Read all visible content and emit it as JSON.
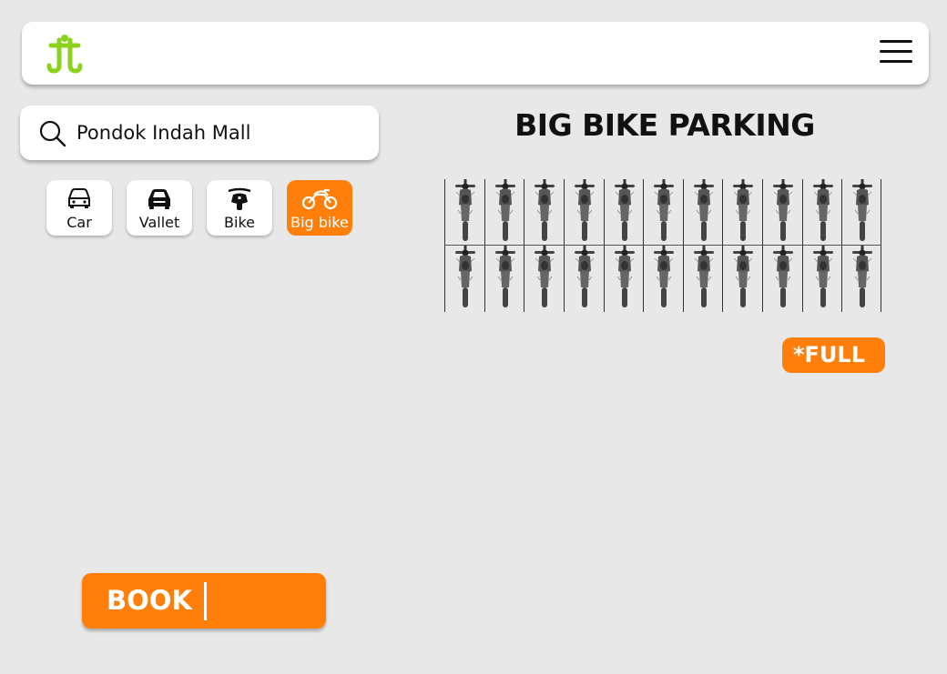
{
  "header": {
    "logo_icon": "ss-logo-icon",
    "menu_icon": "hamburger-menu-icon"
  },
  "search": {
    "value": "Pondok Indah Mall",
    "icon": "search-icon"
  },
  "vehicle_tabs": [
    {
      "label": "Car",
      "icon": "car-icon",
      "active": false
    },
    {
      "label": "Vallet",
      "icon": "valet-car-icon",
      "active": false
    },
    {
      "label": "Bike",
      "icon": "scooter-icon",
      "active": false
    },
    {
      "label": "Big bike",
      "icon": "motorcycle-icon",
      "active": true
    }
  ],
  "parking": {
    "title": "BIG BIKE PARKING",
    "rows": 2,
    "columns": 11,
    "slot_icon": "motorcycle-top-view-icon",
    "status": "*FULL"
  },
  "book": {
    "label": "BOOK"
  },
  "colors": {
    "accent": "#ff7f0a",
    "background": "#e8e8e8",
    "card": "#ffffff",
    "logo": "#8cd11c"
  }
}
